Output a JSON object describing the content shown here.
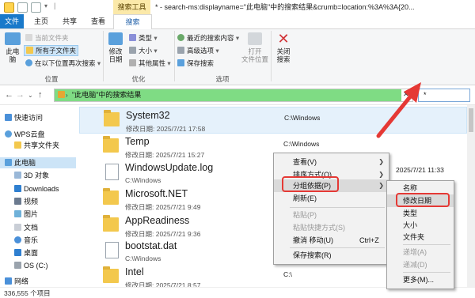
{
  "titlebar": {
    "context_tab_header": "搜索工具",
    "title": "* - search-ms:displayname=\"此电脑\"中的搜索结果&crumb=location:%3A%3A{20..."
  },
  "ribbon_tabs": [
    "文件",
    "主页",
    "共享",
    "查看",
    "搜索"
  ],
  "ribbon": {
    "location": {
      "big_label": "此电\n脑",
      "current_folder": "当前文件夹",
      "all_subfolders": "所有子文件夹",
      "search_again": "在以下位置再次搜索",
      "group_label": "位置"
    },
    "refine": {
      "date_modified": "修改\n日期",
      "kind": "类型",
      "size": "大小",
      "other_properties": "其他属性",
      "group_label": "优化"
    },
    "options": {
      "recent_searches": "最近的搜索内容",
      "advanced_options": "高级选项",
      "save_search": "保存搜索",
      "open_location": "打开\n文件位置",
      "group_label": "选项"
    },
    "close": {
      "label": "关闭\n搜索"
    }
  },
  "address_bar": {
    "text": "\"此电脑\"中的搜索结果",
    "search_value": "*"
  },
  "nav_pane": {
    "items": [
      "快速访问",
      "WPS云盘",
      "共享文件夹",
      "此电脑",
      "3D 对象",
      "Downloads",
      "视频",
      "图片",
      "文档",
      "音乐",
      "桌面",
      "OS (C:)",
      "网络"
    ]
  },
  "files": [
    {
      "name": "System32",
      "sub": "修改日期: 2025/7/21 17:58",
      "path": "C:\\Windows",
      "extra": "",
      "icon": "folder"
    },
    {
      "name": "Temp",
      "sub": "修改日期: 2025/7/21 15:27",
      "path": "C:\\Windows",
      "extra": "",
      "icon": "folder"
    },
    {
      "name": "WindowsUpdate.log",
      "sub": "C:\\Windows",
      "path": "",
      "extra": "2025/7/21 11:33",
      "icon": "doc"
    },
    {
      "name": "Microsoft.NET",
      "sub": "修改日期: 2025/7/21 9:49",
      "path": "",
      "extra": "",
      "icon": "folder"
    },
    {
      "name": "AppReadiness",
      "sub": "修改日期: 2025/7/21 9:36",
      "path": "",
      "extra": "",
      "icon": "folder"
    },
    {
      "name": "bootstat.dat",
      "sub": "C:\\Windows",
      "path": "",
      "extra": "",
      "icon": "doc"
    },
    {
      "name": "Intel",
      "sub": "修改日期: 2025/7/21 8:57",
      "path": "C:\\",
      "extra": "",
      "icon": "folder"
    }
  ],
  "status": {
    "text": "336,555 个项目"
  },
  "context_menu": {
    "items": [
      {
        "label": "查看(V)",
        "shortcut": "",
        "arrow": true,
        "disabled": false
      },
      {
        "label": "排序方式(O)",
        "shortcut": "",
        "arrow": true,
        "disabled": false
      },
      {
        "label": "分组依据(P)",
        "shortcut": "",
        "arrow": true,
        "disabled": false
      },
      {
        "label": "刷新(E)",
        "shortcut": "",
        "arrow": false,
        "disabled": false
      },
      {
        "label": "粘贴(P)",
        "shortcut": "",
        "arrow": false,
        "disabled": true
      },
      {
        "label": "粘贴快捷方式(S)",
        "shortcut": "",
        "arrow": false,
        "disabled": true
      },
      {
        "label": "撤消 移动(U)",
        "shortcut": "Ctrl+Z",
        "arrow": false,
        "disabled": false
      },
      {
        "label": "保存搜索(R)",
        "shortcut": "",
        "arrow": false,
        "disabled": false
      }
    ]
  },
  "submenu": {
    "items": [
      {
        "label": "名称",
        "disabled": false
      },
      {
        "label": "修改日期",
        "disabled": false
      },
      {
        "label": "类型",
        "disabled": false
      },
      {
        "label": "大小",
        "disabled": false
      },
      {
        "label": "文件夹",
        "disabled": false
      },
      {
        "label": "递增(A)",
        "disabled": true
      },
      {
        "label": "递减(D)",
        "disabled": true
      },
      {
        "label": "更多(M)...",
        "disabled": false
      }
    ]
  },
  "colors": {
    "accent": "#1979ca",
    "address_highlight": "#7fdc84",
    "annotation_red": "#e53935",
    "tool_tab": "#fbe9a9"
  }
}
